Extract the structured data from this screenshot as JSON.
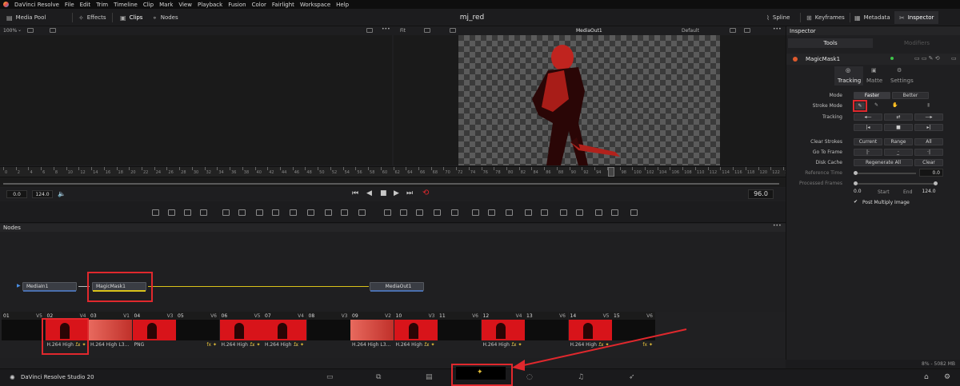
{
  "menu": {
    "items": [
      "DaVinci Resolve",
      "File",
      "Edit",
      "Trim",
      "Timeline",
      "Clip",
      "Mark",
      "View",
      "Playback",
      "Fusion",
      "Color",
      "Fairlight",
      "Workspace",
      "Help"
    ]
  },
  "toolbar": {
    "media_pool": "Media Pool",
    "effects": "Effects",
    "clips": "Clips",
    "nodes": "Nodes",
    "spline": "Spline",
    "keyframes": "Keyframes",
    "metadata": "Metadata",
    "inspector": "Inspector",
    "project_title": "mj_red"
  },
  "viewer": {
    "left_zoom": "100%",
    "right_fit": "Fit",
    "output_name": "MediaOut1",
    "view_mode": "Default"
  },
  "ruler": {
    "ticks": [
      "0",
      "2",
      "4",
      "6",
      "8",
      "10",
      "12",
      "14",
      "16",
      "18",
      "20",
      "22",
      "24",
      "26",
      "28",
      "30",
      "32",
      "34",
      "36",
      "38",
      "40",
      "42",
      "44",
      "46",
      "48",
      "50",
      "52",
      "54",
      "56",
      "58",
      "60",
      "62",
      "64",
      "66",
      "68",
      "70",
      "72",
      "74",
      "76",
      "78",
      "80",
      "82",
      "84",
      "86",
      "88",
      "90",
      "92",
      "94",
      "96",
      "98",
      "100",
      "102",
      "104",
      "106",
      "108",
      "110",
      "112",
      "114",
      "116",
      "118",
      "120",
      "122",
      "124"
    ]
  },
  "transport": {
    "start": "0.0",
    "end": "124.0",
    "current": "96.0"
  },
  "nodes": {
    "header": "Nodes",
    "media_in": "MediaIn1",
    "magic_mask": "MagicMask1",
    "media_out": "MediaOut1"
  },
  "clips": [
    {
      "num": "01",
      "track": "V5",
      "label": "",
      "fx": false,
      "thumb": "dark"
    },
    {
      "num": "02",
      "track": "V4",
      "label": "H.264 High ...",
      "fx": true,
      "thumb": "red"
    },
    {
      "num": "03",
      "track": "V1",
      "label": "H.264 High L3...",
      "fx": false,
      "thumb": "redsmoke"
    },
    {
      "num": "04",
      "track": "V3",
      "label": "PNG",
      "fx": false,
      "thumb": "red"
    },
    {
      "num": "05",
      "track": "V6",
      "label": "",
      "fx": true,
      "thumb": "dark"
    },
    {
      "num": "06",
      "track": "V5",
      "label": "H.264 High ...",
      "fx": true,
      "thumb": "red"
    },
    {
      "num": "07",
      "track": "V4",
      "label": "H.264 High ...",
      "fx": true,
      "thumb": "red"
    },
    {
      "num": "08",
      "track": "V3",
      "label": "",
      "fx": false,
      "thumb": "dark"
    },
    {
      "num": "09",
      "track": "V2",
      "label": "H.264 High L3...",
      "fx": false,
      "thumb": "redsmoke"
    },
    {
      "num": "10",
      "track": "V3",
      "label": "H.264 High ...",
      "fx": true,
      "thumb": "red"
    },
    {
      "num": "11",
      "track": "V6",
      "label": "",
      "fx": false,
      "thumb": "dark"
    },
    {
      "num": "12",
      "track": "V4",
      "label": "H.264 High ...",
      "fx": true,
      "thumb": "red"
    },
    {
      "num": "13",
      "track": "V6",
      "label": "",
      "fx": false,
      "thumb": "dark"
    },
    {
      "num": "14",
      "track": "V5",
      "label": "H.264 High ...",
      "fx": true,
      "thumb": "red"
    },
    {
      "num": "15",
      "track": "V6",
      "label": "",
      "fx": true,
      "thumb": "dark"
    }
  ],
  "status": {
    "memory": "8% - 5082 MB"
  },
  "pagebar": {
    "brand": "DaVinci Resolve Studio 20"
  },
  "inspector": {
    "header": "Inspector",
    "tab_tools": "Tools",
    "tab_modifiers": "Modifiers",
    "node_name": "MagicMask1",
    "subtabs": [
      "Tracking",
      "Matte",
      "Settings"
    ],
    "mode_label": "Mode",
    "mode_faster": "Faster",
    "mode_better": "Better",
    "stroke_mode_label": "Stroke Mode",
    "tracking_label": "Tracking",
    "clear_strokes_label": "Clear Strokes",
    "clear_current": "Current",
    "clear_range": "Range",
    "clear_all": "All",
    "go_to_frame_label": "Go To Frame",
    "disk_cache_label": "Disk Cache",
    "regenerate_all": "Regenerate All",
    "clear": "Clear",
    "reference_time_label": "Reference Time",
    "reference_time_value": "0.0",
    "processed_frames_label": "Processed Frames",
    "start_value": "0.0",
    "start_label": "Start",
    "end_label": "End",
    "end_value": "124.0",
    "post_multiply": "Post Multiply Image"
  },
  "colors": {
    "accent_red": "#e0282d",
    "node_yellow": "#d9c21a",
    "node_blue": "#4a6fae"
  }
}
